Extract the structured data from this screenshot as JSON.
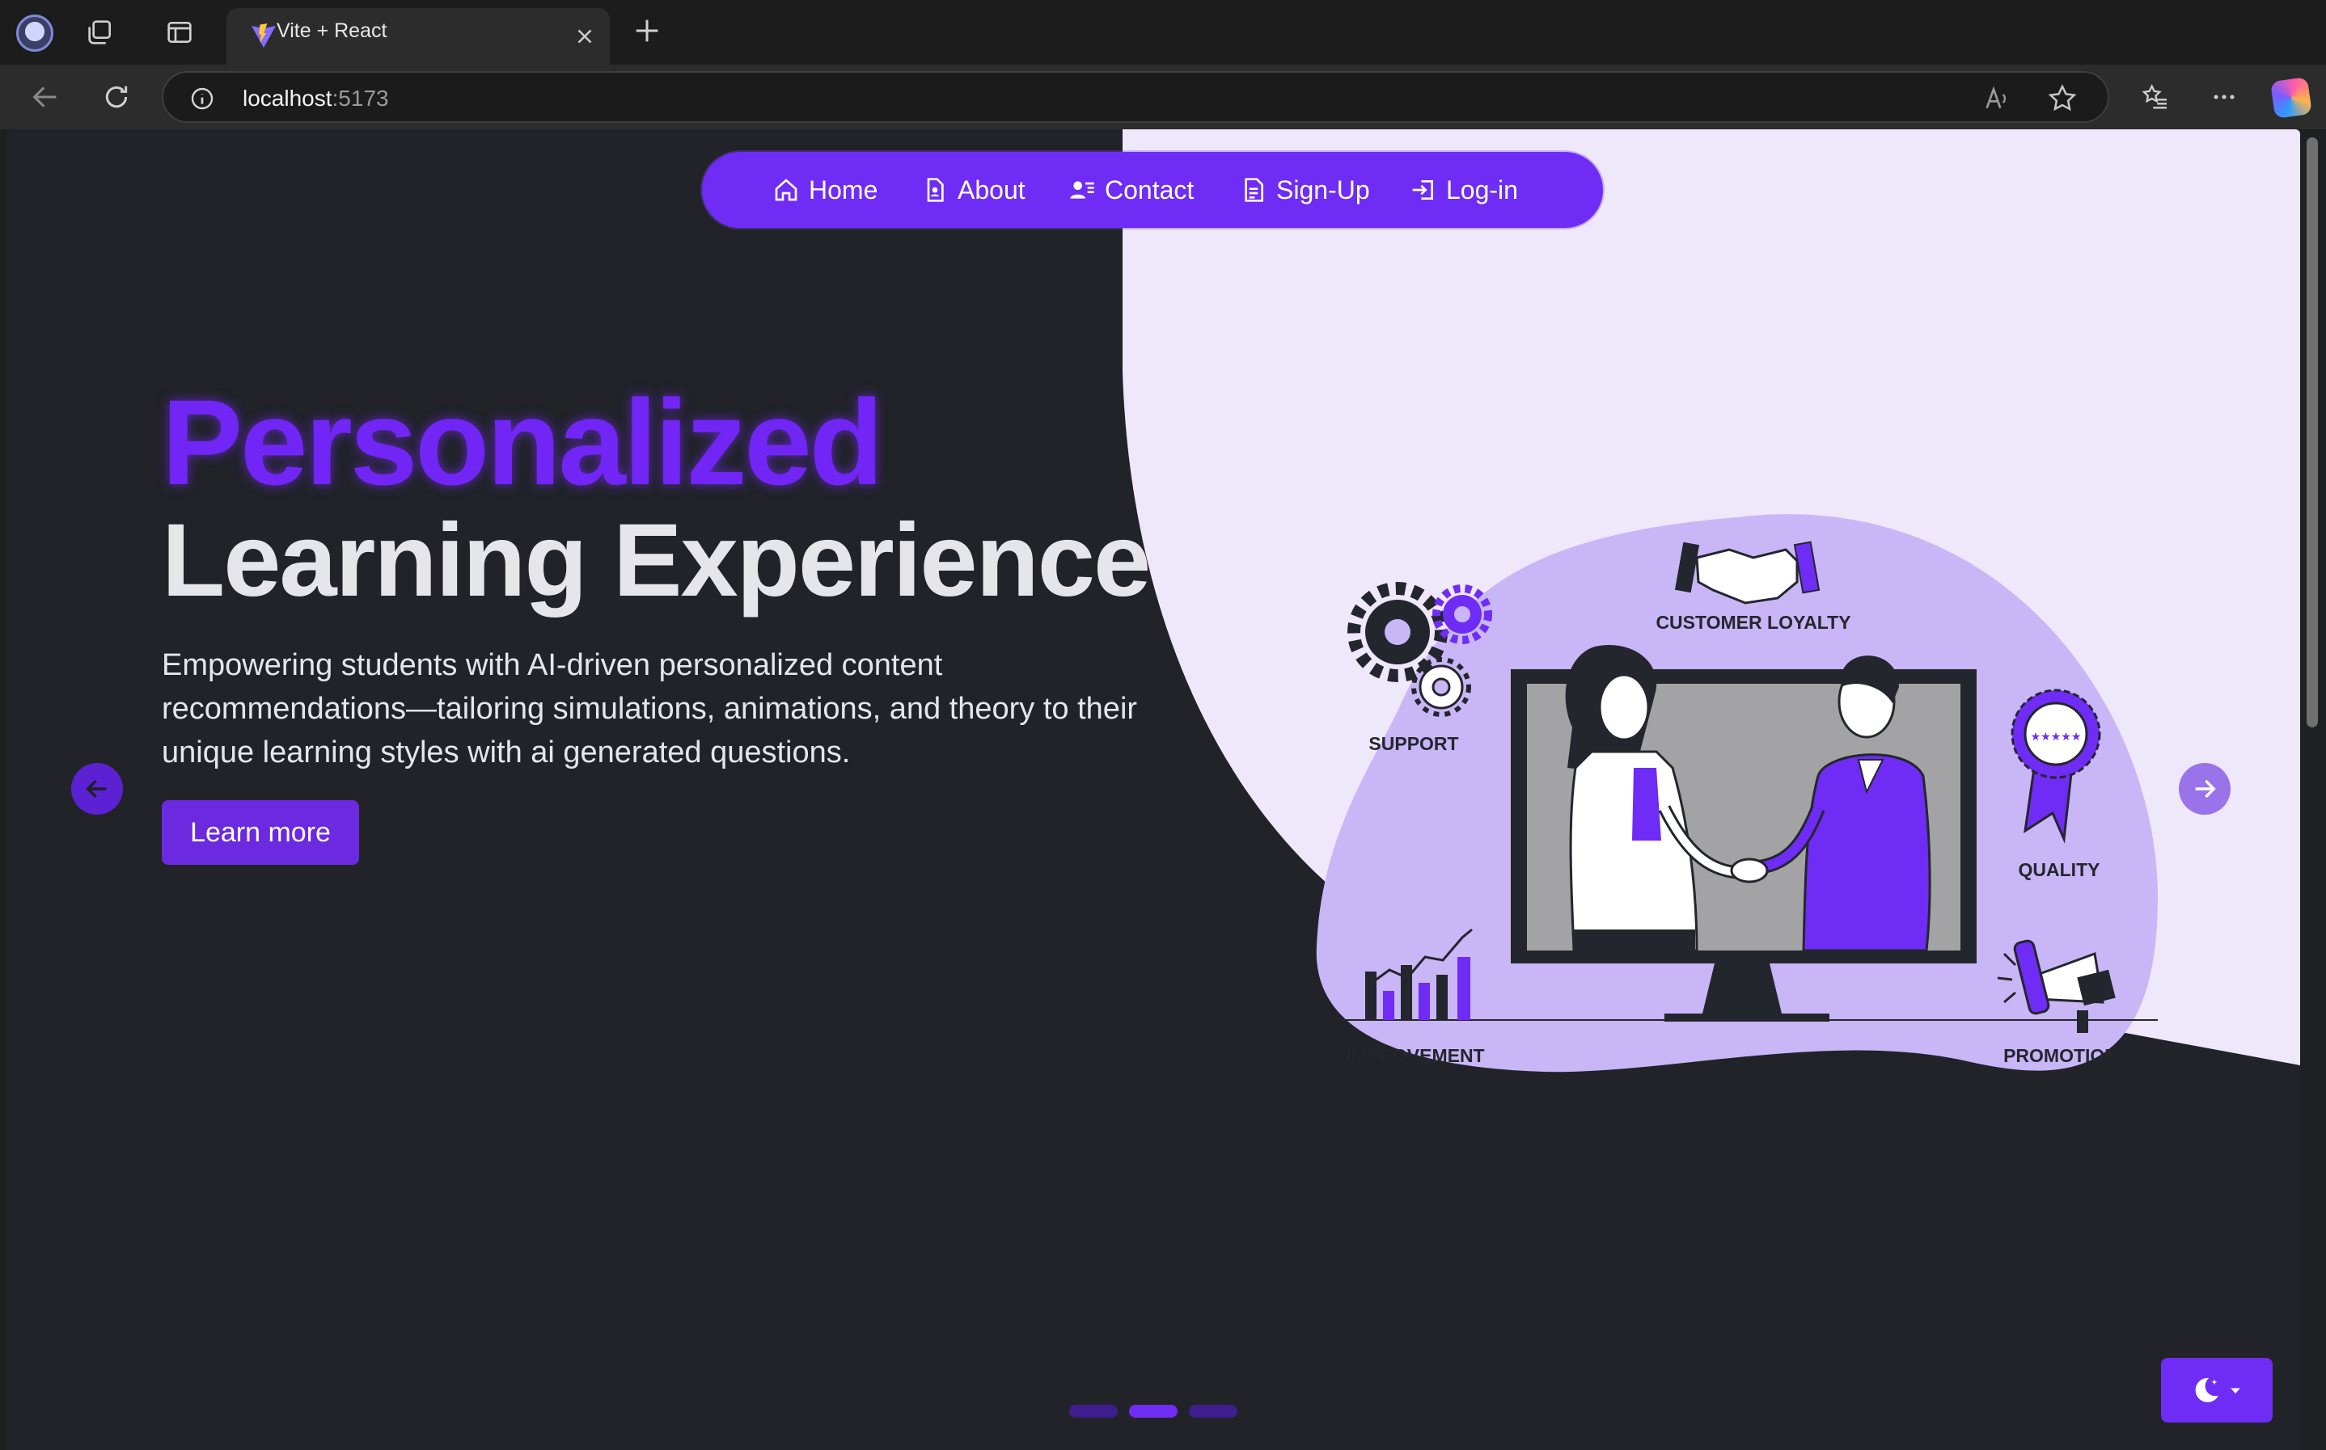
{
  "browser": {
    "tab_title": "Vite + React",
    "url_host": "localhost",
    "url_port": ":5173"
  },
  "nav": {
    "items": [
      {
        "label": "Home",
        "icon": "home-icon"
      },
      {
        "label": "About",
        "icon": "about-document-icon"
      },
      {
        "label": "Contact",
        "icon": "contact-icon"
      },
      {
        "label": "Sign-Up",
        "icon": "signup-document-icon"
      },
      {
        "label": "Log-in",
        "icon": "login-icon"
      }
    ]
  },
  "hero": {
    "title": "Personalized",
    "subtitle": "Learning Experience",
    "description": "Empowering students with AI-driven personalized content recommendations—tailoring simulations, animations, and theory to their unique learning styles with ai generated questions.",
    "cta_label": "Learn more"
  },
  "illustration": {
    "labels": {
      "customer_loyalty": "CUSTOMER LOYALTY",
      "support": "SUPPORT",
      "quality": "QUALITY",
      "improvement": "IMPROVEMENT",
      "promotion": "PROMOTION"
    },
    "badge_stars": "★★★★★"
  },
  "carousel": {
    "slide_count": 3,
    "active_index": 1
  },
  "colors": {
    "accent": "#6f2cf4",
    "title": "#7126f5",
    "page_bg": "#212329",
    "panel_bg": "#efe8fb",
    "blob": "#c9b6f7"
  },
  "theme_toggle": {
    "icon": "moon-stars-icon"
  }
}
